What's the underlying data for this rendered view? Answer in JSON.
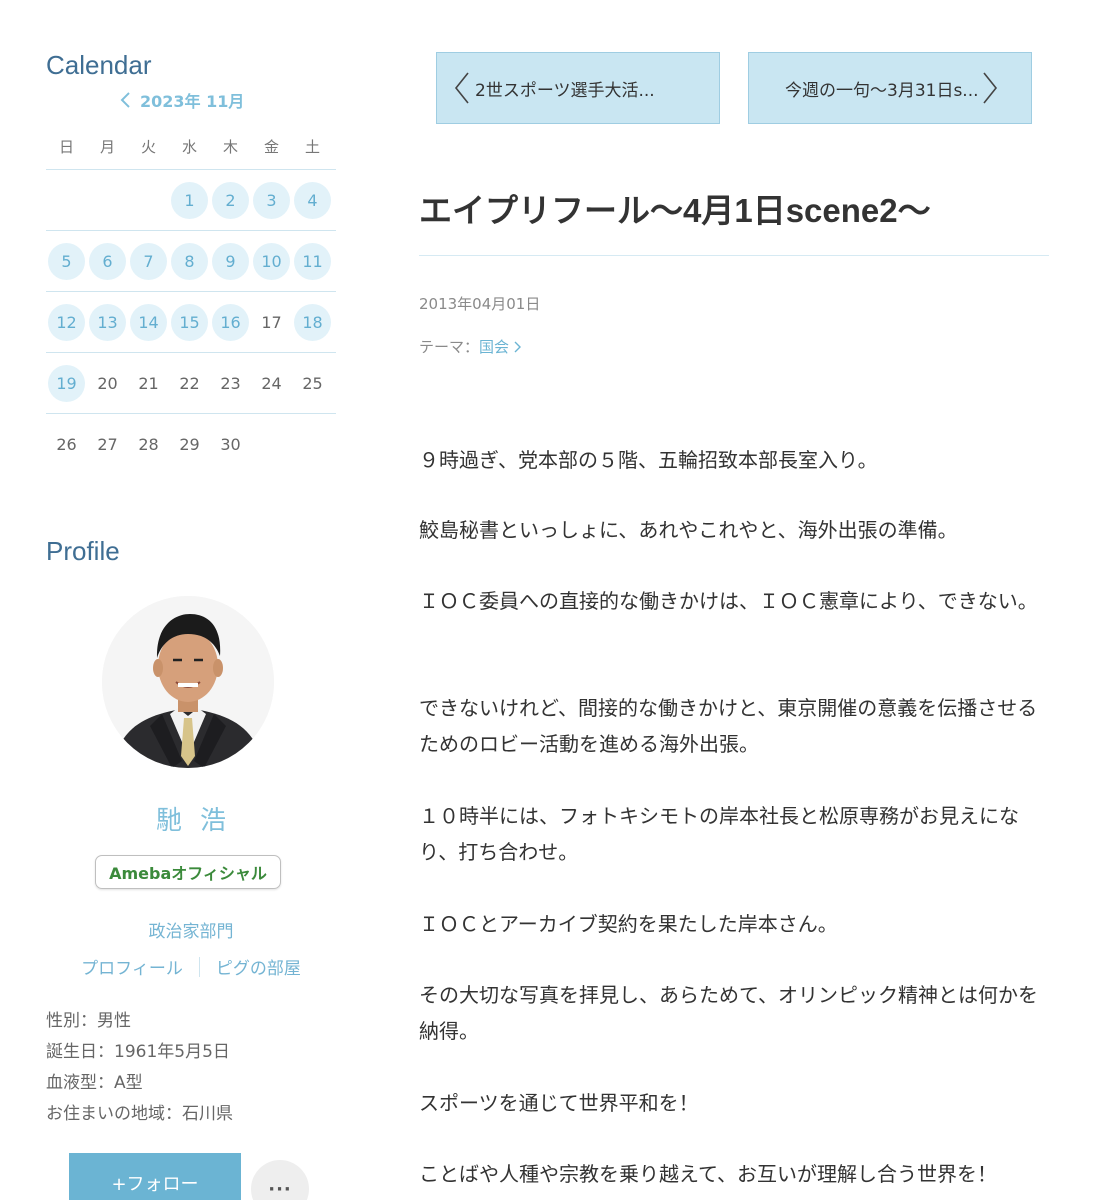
{
  "calendar": {
    "title": "Calendar",
    "month_label": "2023年 11月",
    "weekdays": [
      "日",
      "月",
      "火",
      "水",
      "木",
      "金",
      "土"
    ],
    "weeks": [
      [
        null,
        null,
        null,
        {
          "d": "1",
          "posted": true
        },
        {
          "d": "2",
          "posted": true
        },
        {
          "d": "3",
          "posted": true
        },
        {
          "d": "4",
          "posted": true
        }
      ],
      [
        {
          "d": "5",
          "posted": true
        },
        {
          "d": "6",
          "posted": true
        },
        {
          "d": "7",
          "posted": true
        },
        {
          "d": "8",
          "posted": true
        },
        {
          "d": "9",
          "posted": true
        },
        {
          "d": "10",
          "posted": true
        },
        {
          "d": "11",
          "posted": true
        }
      ],
      [
        {
          "d": "12",
          "posted": true
        },
        {
          "d": "13",
          "posted": true
        },
        {
          "d": "14",
          "posted": true
        },
        {
          "d": "15",
          "posted": true
        },
        {
          "d": "16",
          "posted": true
        },
        {
          "d": "17",
          "posted": false
        },
        {
          "d": "18",
          "posted": true
        }
      ],
      [
        {
          "d": "19",
          "posted": true
        },
        {
          "d": "20",
          "posted": false
        },
        {
          "d": "21",
          "posted": false
        },
        {
          "d": "22",
          "posted": false
        },
        {
          "d": "23",
          "posted": false
        },
        {
          "d": "24",
          "posted": false
        },
        {
          "d": "25",
          "posted": false
        }
      ],
      [
        {
          "d": "26",
          "posted": false
        },
        {
          "d": "27",
          "posted": false
        },
        {
          "d": "28",
          "posted": false
        },
        {
          "d": "29",
          "posted": false
        },
        {
          "d": "30",
          "posted": false
        },
        null,
        null
      ]
    ]
  },
  "profile": {
    "title": "Profile",
    "name": "馳浩",
    "badge": "Amebaオフィシャル",
    "category": "政治家部門",
    "links": [
      "プロフィール",
      "ピグの部屋"
    ],
    "info": [
      "性別：男性",
      "誕生日：1961年5月5日",
      "血液型：A型",
      "お住まいの地域：石川県"
    ],
    "follow_label": "+フォロー",
    "more_label": "···"
  },
  "nav": {
    "prev_label": "2世スポーツ選手大活...",
    "next_label": "今週の一句〜3月31日s..."
  },
  "entry": {
    "title": "エイプリフール〜4月1日scene2〜",
    "date": "2013年04月01日",
    "theme_prefix": "テーマ：",
    "theme": "国会",
    "paragraphs": [
      "９時過ぎ、党本部の５階、五輪招致本部長室入り。",
      "鮫島秘書といっしょに、あれやこれやと、海外出張の準備。",
      "ＩＯＣ委員への直接的な働きかけは、ＩＯＣ憲章により、できない。",
      "できないけれど、間接的な働きかけと、東京開催の意義を伝播させるためのロビー活動を進める海外出張。",
      "１０時半には、フォトキシモトの岸本社長と松原専務がお見えになり、打ち合わせ。",
      "ＩＯＣとアーカイブ契約を果たした岸本さん。",
      "その大切な写真を拝見し、あらためて、オリンピック精神とは何かを納得。",
      "スポーツを通じて世界平和を！",
      "ことばや人種や宗教を乗り越えて、お互いが理解し合う世界を！"
    ]
  },
  "colors": {
    "accent": "#6bb4d3",
    "title_blue": "#3f6e93",
    "nav_bg": "#c9e6f2",
    "day_bg": "#e2f2f9",
    "badge_green": "#3b8a3b"
  }
}
